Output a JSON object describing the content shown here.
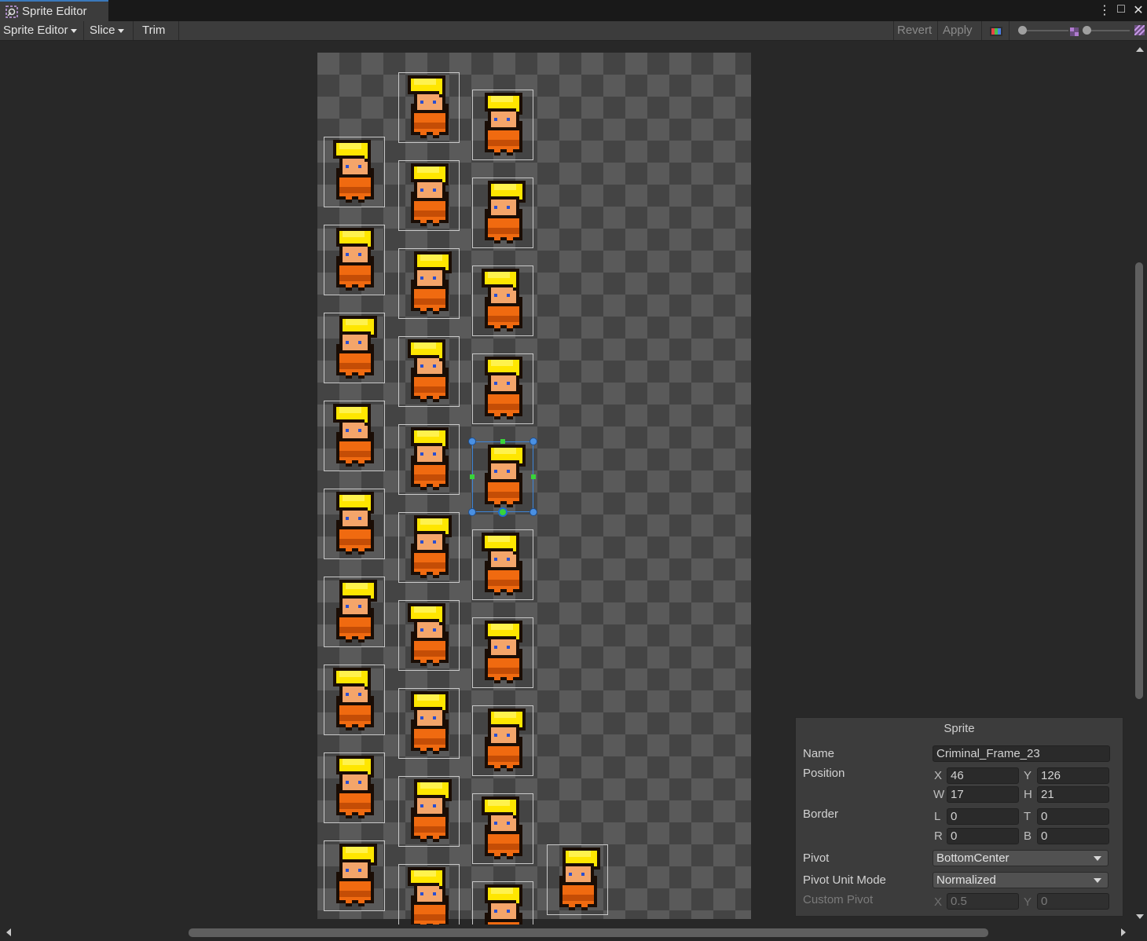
{
  "window": {
    "tab_title": "Sprite Editor",
    "buttons": [
      "⋮",
      "□",
      "✕"
    ]
  },
  "toolbar": {
    "mode_label": "Sprite Editor",
    "slice_label": "Slice",
    "trim_label": "Trim",
    "revert_label": "Revert",
    "apply_label": "Apply"
  },
  "colors": {
    "accent": "#3a79bb",
    "selection": "#3e85d8",
    "handle_green": "#39d43a",
    "hair": "#ffe600",
    "shirt": "#f06a10"
  },
  "sprite_sheet": {
    "columns": [
      {
        "sprites": 9
      },
      {
        "sprites": 10
      },
      {
        "sprites": 10
      },
      {
        "sprites": 1
      }
    ],
    "selected": {
      "column": 2,
      "row": 4
    }
  },
  "sprite_panel": {
    "title": "Sprite",
    "name_label": "Name",
    "name_value": "Criminal_Frame_23",
    "position_label": "Position",
    "x_label": "X",
    "x_value": "46",
    "y_label": "Y",
    "y_value": "126",
    "w_label": "W",
    "w_value": "17",
    "h_label": "H",
    "h_value": "21",
    "border_label": "Border",
    "l_label": "L",
    "l_value": "0",
    "t_label": "T",
    "t_value": "0",
    "r_label": "R",
    "r_value": "0",
    "b_label": "B",
    "b_value": "0",
    "pivot_label": "Pivot",
    "pivot_value": "BottomCenter",
    "pivot_unit_label": "Pivot Unit Mode",
    "pivot_unit_value": "Normalized",
    "custom_pivot_label": "Custom Pivot",
    "cx_label": "X",
    "cx_value": "0.5",
    "cy_label": "Y",
    "cy_value": "0"
  }
}
